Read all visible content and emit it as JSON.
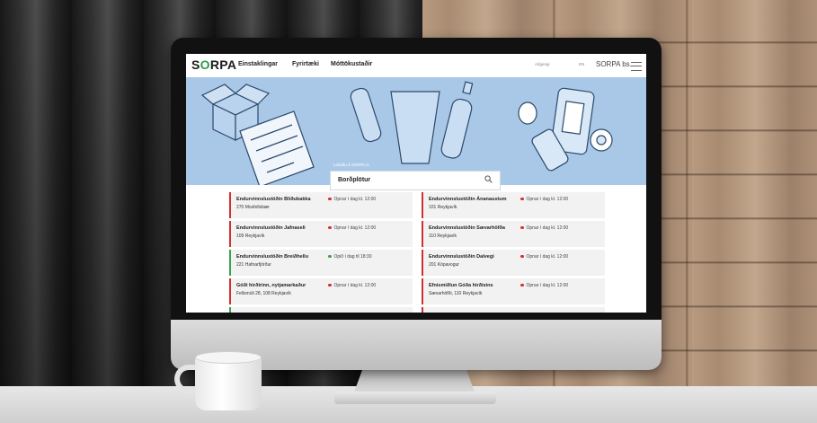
{
  "brand": {
    "logo_text_a": "S",
    "logo_text_o": "O",
    "logo_text_b": "RPA",
    "company": "SORPA bs."
  },
  "nav": {
    "items": [
      "Einstaklingar",
      "Fyrirtæki",
      "Móttökustaðir"
    ],
    "right_links": [
      "Aðgengi",
      "EN"
    ]
  },
  "search": {
    "label": "Leitaðu á SORPA.is",
    "value": "Borðplötur"
  },
  "locations": [
    {
      "name": "Endurvinnslustöðin Blíðubakka",
      "address": "270 Mosfellsbær",
      "status": "Opnar í dag kl. 12:00",
      "open": false
    },
    {
      "name": "Endurvinnslustöðin Ánanaustum",
      "address": "101 Reykjavík",
      "status": "Opnar í dag kl. 12:00",
      "open": false
    },
    {
      "name": "Endurvinnslustöðin Jafnaseli",
      "address": "109 Reykjavík",
      "status": "Opnar í dag kl. 12:00",
      "open": false
    },
    {
      "name": "Endurvinnslustöðin Sævarhöfða",
      "address": "110 Reykjavík",
      "status": "Opnar í dag kl. 12:00",
      "open": false
    },
    {
      "name": "Endurvinnslustöðin Breiðhellu",
      "address": "221 Hafnarfjörður",
      "status": "Opið í dag til 18:30",
      "open": true
    },
    {
      "name": "Endurvinnslustöðin Dalvegi",
      "address": "201 Kópavogur",
      "status": "Opnar í dag kl. 12:00",
      "open": false
    },
    {
      "name": "Góði hirðirinn, nytjamarkaður",
      "address": "Fellsmúli 28, 108 Reykjavík",
      "status": "Opnar í dag kl. 12:00",
      "open": false
    },
    {
      "name": "Efnismiðlun Góða hirðisins",
      "address": "Sævarhöfði, 110 Reykjavík",
      "status": "Opnar í dag kl. 12:00",
      "open": false
    }
  ],
  "colors": {
    "accent_green": "#3ca14f",
    "closed_red": "#d32f2f",
    "hero_blue": "#a9c8e8"
  }
}
